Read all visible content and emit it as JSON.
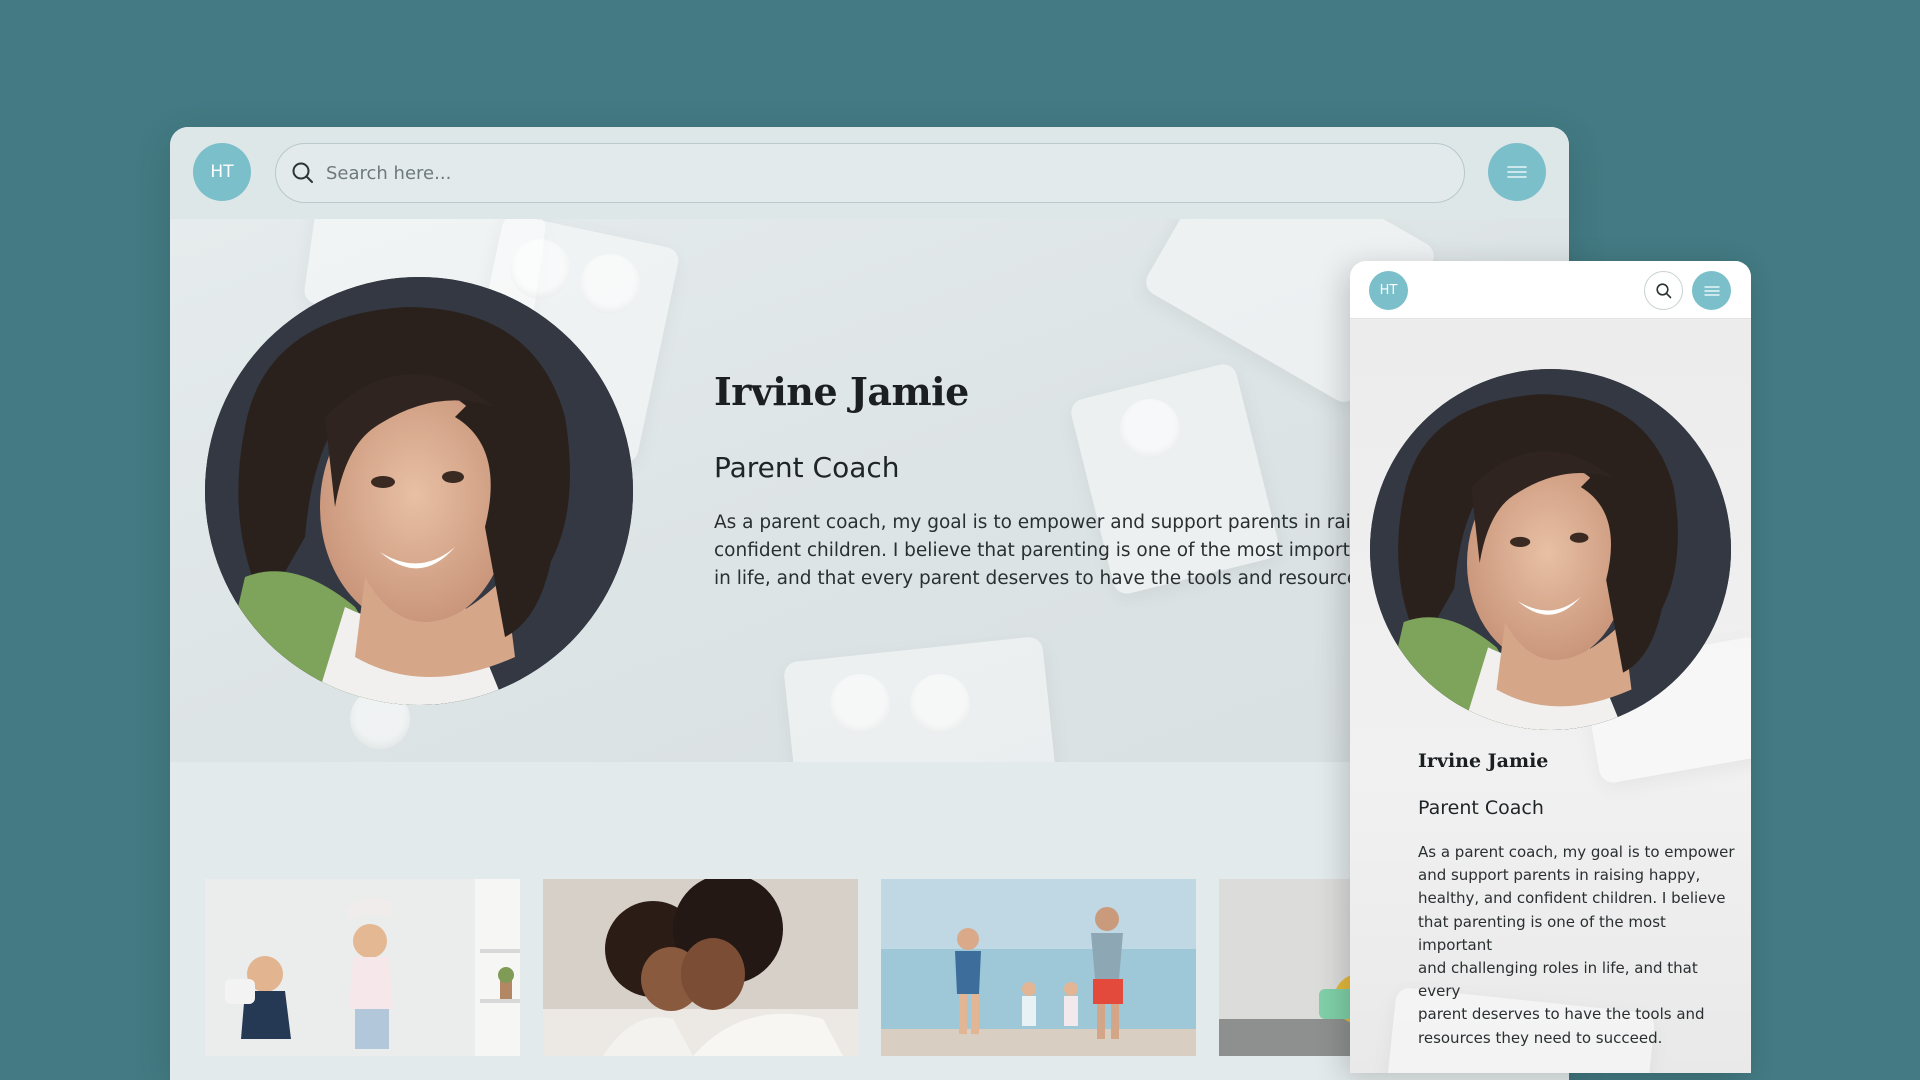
{
  "desktop": {
    "header": {
      "avatar_initials": "HT",
      "search_placeholder": "Search here...",
      "search_icon": "search-icon",
      "menu_icon": "hamburger-menu-icon"
    },
    "hero": {
      "name": "Irvine Jamie",
      "role": "Parent Coach",
      "bio_lines": [
        "As a parent coach, my goal is to empower and support parents in raising h",
        "confident children. I believe that parenting is one of the most important ar",
        "in life, and that every parent deserves to have the tools and resources the"
      ]
    },
    "gallery_count": 4
  },
  "mobile": {
    "header": {
      "avatar_initials": "HT",
      "search_icon": "search-icon",
      "menu_icon": "hamburger-menu-icon"
    },
    "hero": {
      "name": "Irvine Jamie",
      "role": "Parent Coach",
      "bio_lines": [
        "As a parent coach, my goal is to empower",
        "and support parents in raising happy,",
        "healthy, and confident children. I believe",
        "that parenting is one of the most important",
        "and challenging roles in life, and that every",
        "parent deserves to have the tools and",
        "resources they need to succeed."
      ]
    }
  },
  "colors": {
    "background": "#437a83",
    "accent": "#7bbfca",
    "desktop_surface": "#e3eaeb",
    "text_dark": "#1b1f21"
  }
}
